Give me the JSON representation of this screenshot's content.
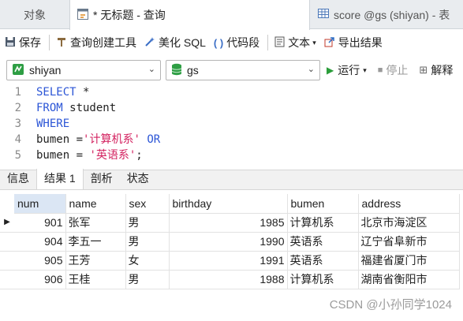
{
  "tabs": {
    "objects": "对象",
    "query": "* 无标题 - 查询",
    "score": "score @gs (shiyan) - 表"
  },
  "toolbar": {
    "save": "保存",
    "query_builder": "查询创建工具",
    "beautify": "美化 SQL",
    "snippet": "代码段",
    "text": "文本",
    "export": "导出结果"
  },
  "connection": {
    "database": "shiyan",
    "schema": "gs",
    "run": "运行",
    "stop": "停止",
    "explain": "解释"
  },
  "editor": {
    "lines": [
      {
        "n": "1",
        "parts": [
          {
            "t": "SELECT",
            "c": "kw"
          },
          {
            "t": " *",
            "c": ""
          }
        ]
      },
      {
        "n": "2",
        "parts": [
          {
            "t": "FROM",
            "c": "kw"
          },
          {
            "t": " student",
            "c": ""
          }
        ]
      },
      {
        "n": "3",
        "parts": [
          {
            "t": "WHERE",
            "c": "kw"
          }
        ]
      },
      {
        "n": "4",
        "parts": [
          {
            "t": "bumen =",
            "c": ""
          },
          {
            "t": "'计算机系'",
            "c": "str"
          },
          {
            "t": " ",
            "c": ""
          },
          {
            "t": "OR",
            "c": "kw"
          }
        ]
      },
      {
        "n": "5",
        "parts": [
          {
            "t": "bumen = ",
            "c": ""
          },
          {
            "t": "'英语系'",
            "c": "str"
          },
          {
            "t": ";",
            "c": ""
          }
        ]
      }
    ]
  },
  "result_tabs": [
    "信息",
    "结果 1",
    "剖析",
    "状态"
  ],
  "grid": {
    "columns": [
      "num",
      "name",
      "sex",
      "birthday",
      "bumen",
      "address"
    ],
    "rows": [
      [
        "901",
        "张军",
        "男",
        "1985",
        "计算机系",
        "北京市海淀区"
      ],
      [
        "904",
        "李五一",
        "男",
        "1990",
        "英语系",
        "辽宁省阜新市"
      ],
      [
        "905",
        "王芳",
        "女",
        "1991",
        "英语系",
        "福建省厦门市"
      ],
      [
        "906",
        "王桂",
        "男",
        "1988",
        "计算机系",
        "湖南省衡阳市"
      ]
    ]
  },
  "watermark": "CSDN @小孙同学1024",
  "colors": {
    "keyword": "#2b55d6",
    "string": "#d3215f",
    "run_icon": "#2a9d3a"
  }
}
